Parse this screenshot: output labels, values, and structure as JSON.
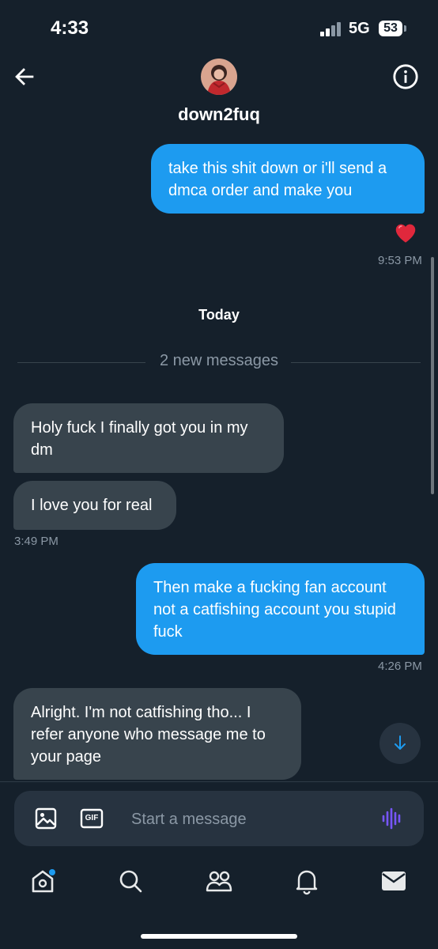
{
  "status_bar": {
    "time": "4:33",
    "network": "5G",
    "battery": "53"
  },
  "header": {
    "username": "down2fuq",
    "back_icon": "arrow-left-icon",
    "info_icon": "info-circle-icon",
    "avatar_icon": "profile-avatar"
  },
  "messages": {
    "m1": "take this shit down or i'll send a dmca order and make you",
    "m1_reaction": "❤️",
    "m1_time": "9:53 PM",
    "today": "Today",
    "new_messages": "2 new messages",
    "m2": "Holy fuck I finally got you in my dm",
    "m3": "I love you for real",
    "m3_time": "3:49 PM",
    "m4": "Then make a fucking fan account not a catfishing account you stupid fuck",
    "m4_time": "4:26 PM",
    "m5": "Alright. I'm not catfishing tho... I refer anyone who message me to your page"
  },
  "composer": {
    "placeholder": "Start a message",
    "gif_label": "GIF",
    "image_icon": "image-icon",
    "voice_icon": "voice-waveform-icon"
  },
  "tabbar": {
    "items": [
      "home-icon",
      "search-icon",
      "communities-icon",
      "notifications-icon",
      "messages-icon"
    ]
  },
  "colors": {
    "background": "#15202b",
    "outgoing_bubble": "#1d9bf0",
    "incoming_bubble": "#38444d",
    "secondary_text": "#8b98a5",
    "voice_accent": "#7856ff"
  }
}
